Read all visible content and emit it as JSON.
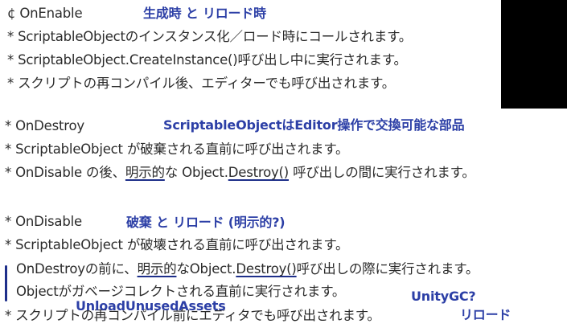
{
  "section1": {
    "heading": "¢ OnEnable",
    "note": "生成時 と リロード時",
    "lines": [
      "* ScriptableObjectのインスタンス化／ロード時にコールされます。",
      "* ScriptableObject.CreateInstance()呼び出し中に実行されます。",
      "* スクリプトの再コンパイル後、エディターでも呼び出されます。"
    ]
  },
  "section2": {
    "heading": "* OnDestroy",
    "note": "ScriptableObjectはEditor操作で交換可能な部品",
    "line1": "* ScriptableObject が破棄される直前に呼び出されます。",
    "line2": {
      "pre": "* OnDisable の後、",
      "u1": "明示的",
      "mid": "な Object.",
      "u2": "Destroy()",
      "post": " 呼び出しの間に実行されます。"
    }
  },
  "section3": {
    "heading": "* OnDisable",
    "note": "破棄 と リロード (明示的?)",
    "line1": "* ScriptableObject が破壊される直前に呼び出されます。",
    "line2": {
      "pre": "OnDestroyの前に、",
      "u1": "明示的",
      "mid": "なObject.",
      "u2": "Destroy()",
      "post": "呼び出しの際に実行されます。"
    },
    "line3": "Objectがガベージコレクトされる直前に実行されます。",
    "note_gc": "UnityGC?",
    "note_unload": "UnloadUnusedAssets",
    "line4": "* スクリプトの再コンパイル前にエディタでも呼び出されます。",
    "note_reload": "リロード"
  },
  "colors": {
    "text": "#2b2b2b",
    "annotation": "#2c3fa6",
    "redaction": "#000000"
  }
}
